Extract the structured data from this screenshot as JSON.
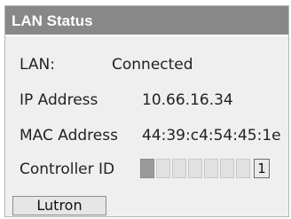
{
  "panel": {
    "title": "LAN Status"
  },
  "lan": {
    "label": "LAN:",
    "value": "Connected"
  },
  "ip": {
    "label": "IP Address",
    "value": "10.66.16.34"
  },
  "mac": {
    "label": "MAC Address",
    "value": "44:39:c4:54:45:1e"
  },
  "controller_id": {
    "label": "Controller ID",
    "value": "1",
    "cells": [
      "filled",
      "empty",
      "empty",
      "empty",
      "empty",
      "empty",
      "empty"
    ]
  },
  "button": {
    "label": "Lutron"
  },
  "colors": {
    "title_bar": "#888888",
    "panel_bg": "#efefef"
  }
}
